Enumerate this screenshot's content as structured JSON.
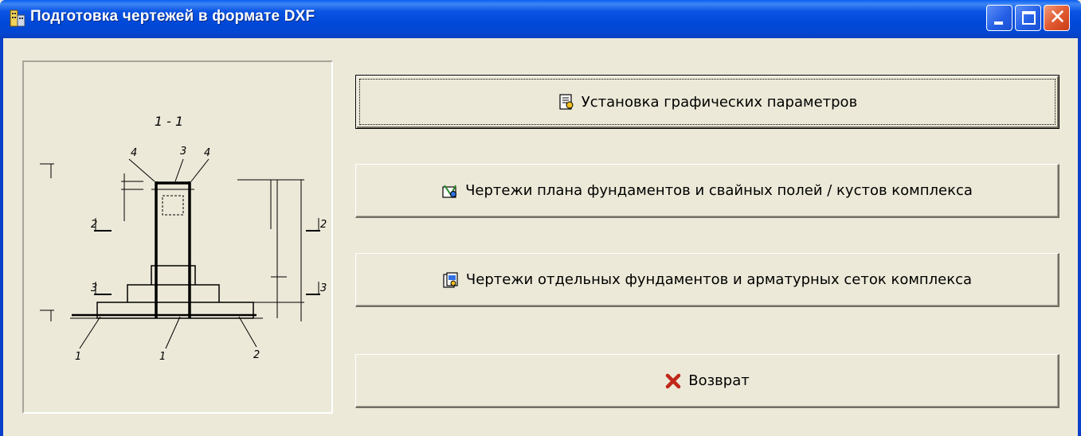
{
  "window": {
    "title": "Подготовка чертежей в формате DXF",
    "app_icon": "building-icon",
    "controls": {
      "minimize": "minimize-icon",
      "maximize": "maximize-icon",
      "close": "close-icon"
    }
  },
  "drawing": {
    "section_label": "1 - 1",
    "markers": {
      "left_2": "2",
      "left_3": "3",
      "right_2": "2",
      "right_3": "3",
      "top_4_left": "4",
      "top_3": "3",
      "top_4_right": "4",
      "bottom_1_left": "1",
      "bottom_1_mid": "1",
      "bottom_2": "2"
    }
  },
  "buttons": [
    {
      "label": "Установка графических параметров",
      "icon": "settings-document-icon"
    },
    {
      "label": "Чертежи плана фундаментов и свайных полей / кустов комплекса",
      "icon": "drawing-plan-icon"
    },
    {
      "label": "Чертежи отдельных фундаментов и арматурных сеток комплекса",
      "icon": "drawing-sheets-icon"
    },
    {
      "label": "Возврат",
      "icon": "red-x-icon"
    }
  ],
  "colors": {
    "titlebar": "#0a54e4",
    "face": "#ece9d8",
    "close_red": "#e15b32",
    "return_x": "#c0281b"
  }
}
